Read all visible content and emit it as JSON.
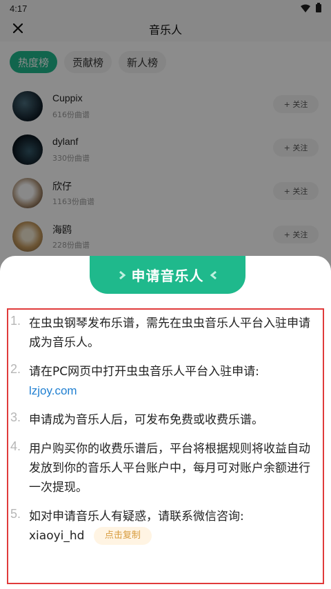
{
  "status_bar": {
    "time": "4:17"
  },
  "header": {
    "title": "音乐人"
  },
  "tabs": [
    {
      "label": "热度榜",
      "active": true
    },
    {
      "label": "贡献榜",
      "active": false
    },
    {
      "label": "新人榜",
      "active": false
    }
  ],
  "musicians": [
    {
      "name": "Cuppix",
      "count": "616份曲谱",
      "follow": "+ 关注"
    },
    {
      "name": "dylanf",
      "count": "330份曲谱",
      "follow": "+ 关注"
    },
    {
      "name": "欣仔",
      "count": "1163份曲谱",
      "follow": "+ 关注"
    },
    {
      "name": "海鸥",
      "count": "228份曲谱",
      "follow": "+ 关注"
    }
  ],
  "sheet": {
    "title": "申请音乐人",
    "items": [
      {
        "num": "1.",
        "text": "在虫虫钢琴发布乐谱，需先在虫虫音乐人平台入驻申请成为音乐人。"
      },
      {
        "num": "2.",
        "text": "请在PC网页中打开虫虫音乐人平台入驻申请:",
        "link": "lzjoy.com"
      },
      {
        "num": "3.",
        "text": "申请成为音乐人后，可发布免费或收费乐谱。"
      },
      {
        "num": "4.",
        "text": "用户购买你的收费乐谱后，平台将根据规则将收益自动发放到你的音乐人平台账户中，每月可对账户余额进行一次提现。"
      },
      {
        "num": "5.",
        "text": "如对申请音乐人有疑惑，请联系微信咨询:",
        "wechat": "xiaoyi_hd",
        "copy_label": "点击复制"
      }
    ]
  },
  "colors": {
    "accent": "#1fb98c",
    "link": "#1f7fd1",
    "highlight_border": "#e03a3a"
  },
  "icons": [
    "wifi-icon",
    "battery-icon",
    "close-icon",
    "chevron-right-icon",
    "chevron-left-icon"
  ]
}
